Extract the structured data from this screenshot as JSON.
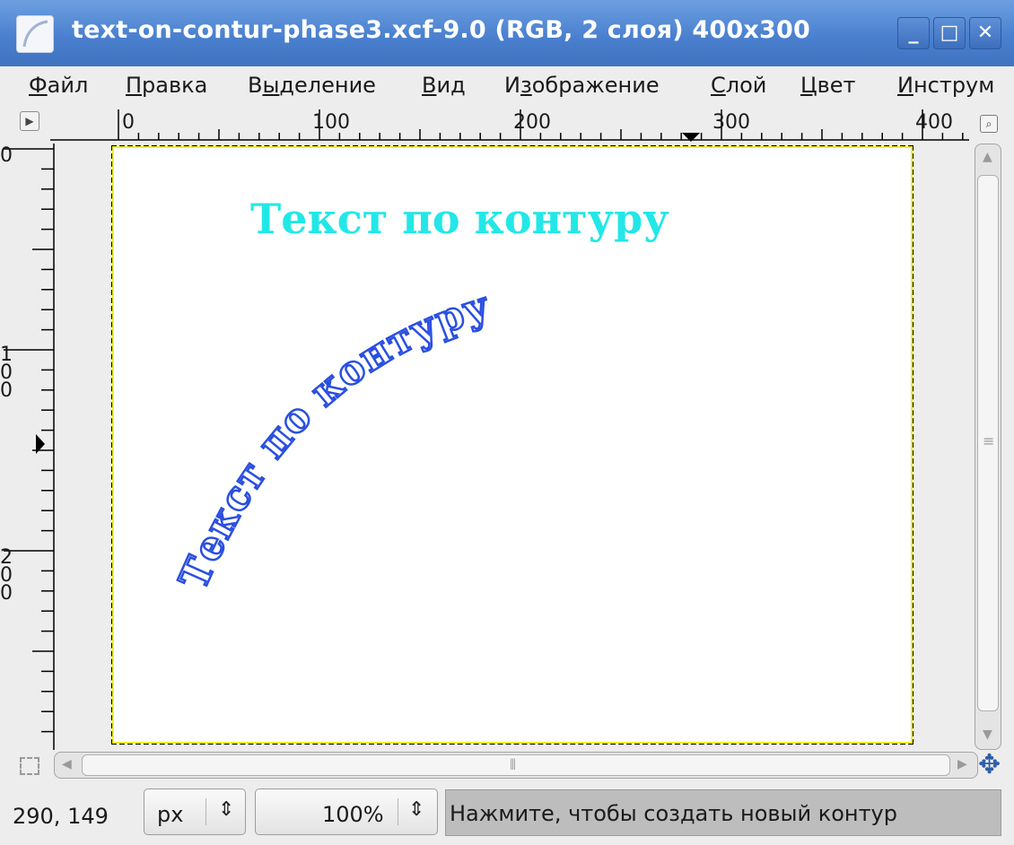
{
  "window": {
    "title": "text-on-contur-phase3.xcf-9.0 (RGB, 2 слоя) 400x300",
    "minimize": "_",
    "maximize": "□",
    "close": "✕"
  },
  "menu": [
    {
      "pre": "",
      "ul": "Ф",
      "post": "айл"
    },
    {
      "pre": "",
      "ul": "П",
      "post": "равка"
    },
    {
      "pre": "В",
      "ul": "ы",
      "post": "деление"
    },
    {
      "pre": "",
      "ul": "В",
      "post": "ид"
    },
    {
      "pre": "И",
      "ul": "з",
      "post": "ображение"
    },
    {
      "pre": "",
      "ul": "С",
      "post": "лой"
    },
    {
      "pre": "",
      "ul": "Ц",
      "post": "вет"
    },
    {
      "pre": "",
      "ul": "И",
      "post": "нструм"
    }
  ],
  "rulers": {
    "h_labels": [
      "0",
      "100",
      "200",
      "300",
      "400"
    ],
    "v_labels": [
      "0",
      "1\n0\n0",
      "2\n0\n0"
    ]
  },
  "canvas": {
    "title_text": "Текст по контуру",
    "title_color": "#23e7e7",
    "curved_text": "Текст по контуру",
    "curved_color": "#2a4fe0"
  },
  "status": {
    "coords": "290, 149",
    "unit": "px",
    "zoom": "100%",
    "message": "Нажмите, чтобы создать новый контур"
  },
  "icons": [
    "gimp-app-icon",
    "menu-arrow-icon",
    "zoom-fit-icon",
    "quick-mask-icon",
    "navigate-icon"
  ]
}
